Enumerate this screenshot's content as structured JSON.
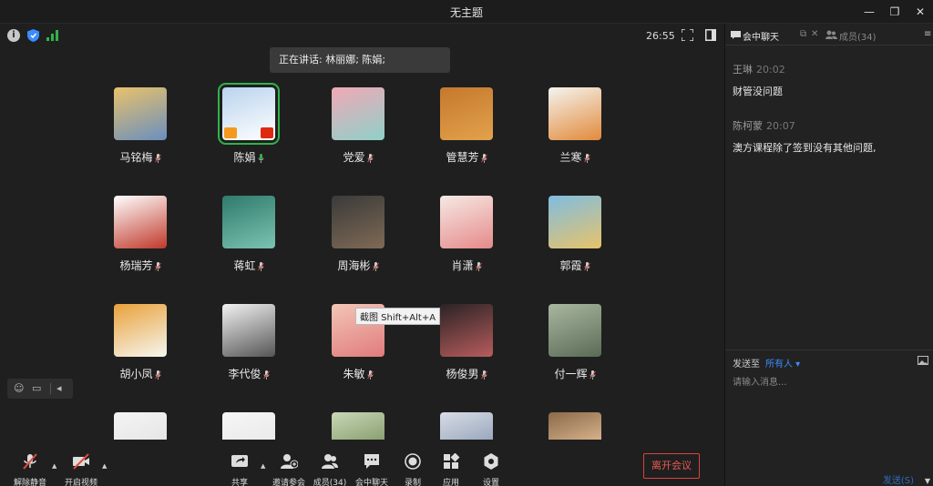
{
  "window": {
    "title": "无主题",
    "controls": [
      "minimize-icon",
      "restore-icon",
      "close-icon"
    ]
  },
  "topbar": {
    "timer": "26:55"
  },
  "speaking": {
    "text": "正在讲话: 林丽娜; 陈娟;"
  },
  "participants": [
    {
      "name": "马铭梅",
      "colors": [
        "#e9c26a",
        "#6a8fbf"
      ]
    },
    {
      "name": "陈娟",
      "colors": [
        "#b9d3ee",
        "#ffffff"
      ],
      "active": true
    },
    {
      "name": "党爱",
      "colors": [
        "#f0a9b7",
        "#8fd0c8"
      ]
    },
    {
      "name": "管慧芳",
      "colors": [
        "#c5782e",
        "#e3a24b"
      ]
    },
    {
      "name": "兰寒",
      "colors": [
        "#f4f4f0",
        "#e28a3a"
      ]
    },
    {
      "name": "杨瑞芳",
      "colors": [
        "#ffffff",
        "#c0392b"
      ]
    },
    {
      "name": "蒋虹",
      "colors": [
        "#2f7a6b",
        "#7bc3b2"
      ]
    },
    {
      "name": "周海彬",
      "colors": [
        "#3a3a3a",
        "#7f6a55"
      ]
    },
    {
      "name": "肖潇",
      "colors": [
        "#f6e9e4",
        "#e58a8a"
      ]
    },
    {
      "name": "郭霞",
      "colors": [
        "#7fbde0",
        "#e8c36a"
      ]
    },
    {
      "name": "胡小凤",
      "colors": [
        "#e9a13a",
        "#f6f6f0"
      ]
    },
    {
      "name": "李代俊",
      "colors": [
        "#f2f2f2",
        "#555555"
      ]
    },
    {
      "name": "朱敏",
      "colors": [
        "#f3c6b8",
        "#e07b7b"
      ]
    },
    {
      "name": "杨俊男",
      "colors": [
        "#2a2325",
        "#b85c5c"
      ]
    },
    {
      "name": "付一辉",
      "colors": [
        "#a9b7a0",
        "#5a6b55"
      ]
    },
    {
      "name": "",
      "colors": [
        "#f4f4f4",
        "#e6e6e6"
      ]
    },
    {
      "name": "",
      "colors": [
        "#f6f6f6",
        "#eaeaea"
      ]
    },
    {
      "name": "",
      "colors": [
        "#c9d8b8",
        "#8aa070"
      ]
    },
    {
      "name": "",
      "colors": [
        "#d8dde6",
        "#9aa8bd"
      ]
    },
    {
      "name": "",
      "colors": [
        "#8a6a4a",
        "#d6b08a"
      ]
    }
  ],
  "tooltip": {
    "text": "截图 Shift+Alt+A"
  },
  "toolbar": {
    "mute_label": "解除静音",
    "video_label": "开启视频",
    "share_label": "共享",
    "invite_label": "邀请参会",
    "members_label": "成员(34)",
    "chat_label": "会中聊天",
    "record_label": "录制",
    "apps_label": "应用",
    "settings_label": "设置",
    "leave_label": "离开会议"
  },
  "sidebar": {
    "chat_tab": "会中聊天",
    "members_tab": "成员(34)",
    "messages": [
      {
        "sender": "王琳",
        "time": "20:02",
        "text": "财管没问题"
      },
      {
        "sender": "陈柯蒙",
        "time": "20:07",
        "text": "澳方课程除了签到没有其他问题,"
      }
    ],
    "send_to_label": "发送至",
    "send_to_target": "所有人",
    "input_placeholder": "请输入消息...",
    "send_label": "发送(S)"
  },
  "colors": {
    "accent_green": "#2fb34a",
    "leave_red": "#d9453b",
    "link_blue": "#3b8cff"
  }
}
